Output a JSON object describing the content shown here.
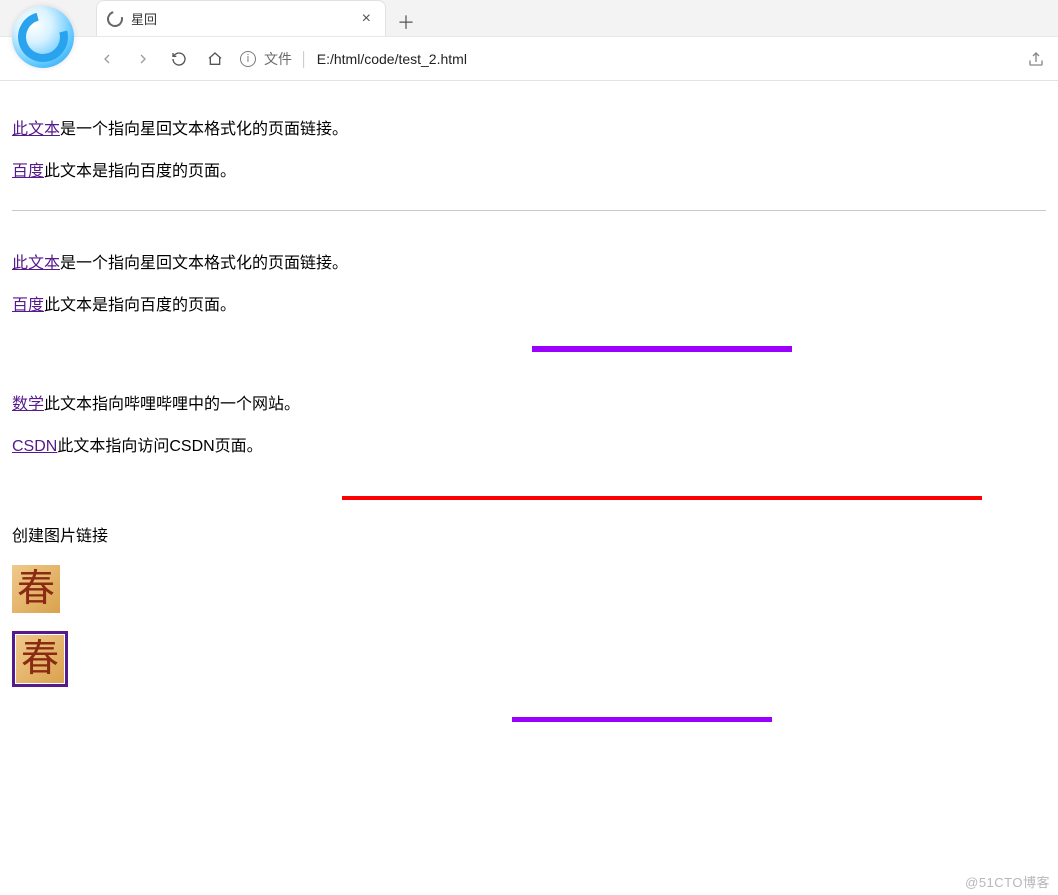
{
  "chrome": {
    "tab": {
      "title": "星回"
    },
    "address": {
      "scheme_label": "文件",
      "url": "E:/html/code/test_2.html"
    }
  },
  "content": {
    "p1": {
      "link": "此文本",
      "rest": "是一个指向星回文本格式化的页面链接。"
    },
    "p2": {
      "link": "百度",
      "rest": "此文本是指向百度的页面。"
    },
    "p3": {
      "link": "此文本",
      "rest": "是一个指向星回文本格式化的页面链接。"
    },
    "p4": {
      "link": "百度",
      "rest": "此文本是指向百度的页面。"
    },
    "p5": {
      "link": "数学",
      "rest": "此文本指向哔哩哔哩中的一个网站。"
    },
    "p6": {
      "link": "CSDN",
      "rest": "此文本指向访问CSDN页面。"
    },
    "img_heading": "创建图片链接",
    "img_glyph": "春"
  },
  "watermark": "@51CTO博客"
}
